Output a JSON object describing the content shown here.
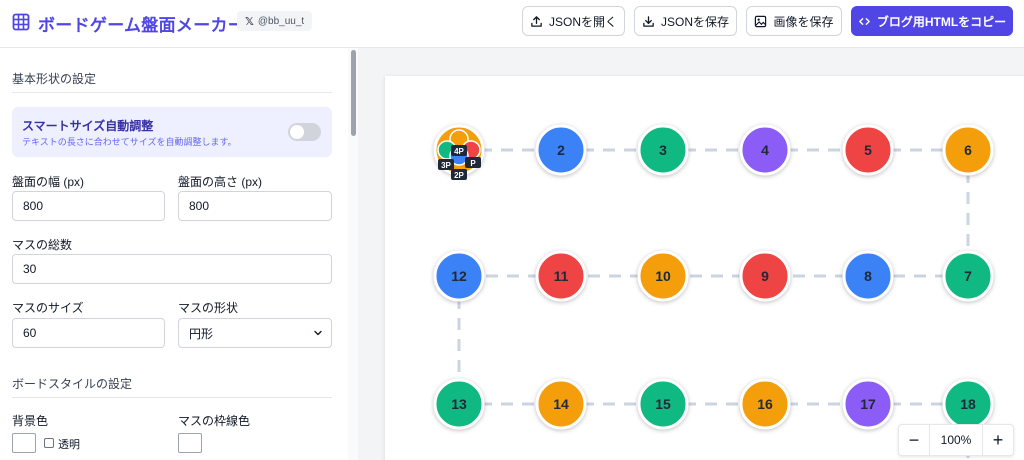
{
  "header": {
    "title": "ボードゲーム盤面メーカー",
    "x_handle": "@bb_uu_t",
    "buttons": {
      "open_json": "JSONを開く",
      "save_json": "JSONを保存",
      "save_image": "画像を保存",
      "copy_html": "ブログ用HTMLをコピー"
    }
  },
  "sidebar": {
    "basic_section_title": "基本形状の設定",
    "smart_size": {
      "title": "スマートサイズ自動調整",
      "description": "テキストの長さに合わせてサイズを自動調整します。",
      "enabled": false
    },
    "board_width": {
      "label": "盤面の幅 (px)",
      "value": "800"
    },
    "board_height": {
      "label": "盤面の高さ (px)",
      "value": "800"
    },
    "total_cells": {
      "label": "マスの総数",
      "value": "30"
    },
    "cell_size": {
      "label": "マスのサイズ",
      "value": "60"
    },
    "cell_shape": {
      "label": "マスの形状",
      "value": "円形"
    },
    "style_section_title": "ボードスタイルの設定",
    "bg_color": {
      "label": "背景色",
      "transparent_label": "透明",
      "color": "#ffffff"
    },
    "cell_border_color": {
      "label": "マスの枠線色",
      "color": "#ffffff"
    }
  },
  "board": {
    "cells": [
      {
        "n": "",
        "color": "#f59e0b"
      },
      {
        "n": "2",
        "color": "#3b82f6"
      },
      {
        "n": "3",
        "color": "#10b981"
      },
      {
        "n": "4",
        "color": "#8b5cf6"
      },
      {
        "n": "5",
        "color": "#ef4444"
      },
      {
        "n": "6",
        "color": "#f59e0b"
      },
      {
        "n": "7",
        "color": "#10b981"
      },
      {
        "n": "8",
        "color": "#3b82f6"
      },
      {
        "n": "9",
        "color": "#ef4444"
      },
      {
        "n": "10",
        "color": "#f59e0b"
      },
      {
        "n": "11",
        "color": "#ef4444"
      },
      {
        "n": "12",
        "color": "#3b82f6"
      },
      {
        "n": "13",
        "color": "#10b981"
      },
      {
        "n": "14",
        "color": "#f59e0b"
      },
      {
        "n": "15",
        "color": "#10b981"
      },
      {
        "n": "16",
        "color": "#f59e0b"
      },
      {
        "n": "17",
        "color": "#8b5cf6"
      },
      {
        "n": "18",
        "color": "#10b981"
      }
    ],
    "players": [
      {
        "label": "4P",
        "color": "#f59e0b"
      },
      {
        "label": "3P",
        "color": "#10b981"
      },
      {
        "label": "P",
        "color": "#ef4444"
      },
      {
        "label": "2P",
        "color": "#3b82f6"
      }
    ]
  },
  "zoom": {
    "value": "100%",
    "minus": "−",
    "plus": "+"
  }
}
